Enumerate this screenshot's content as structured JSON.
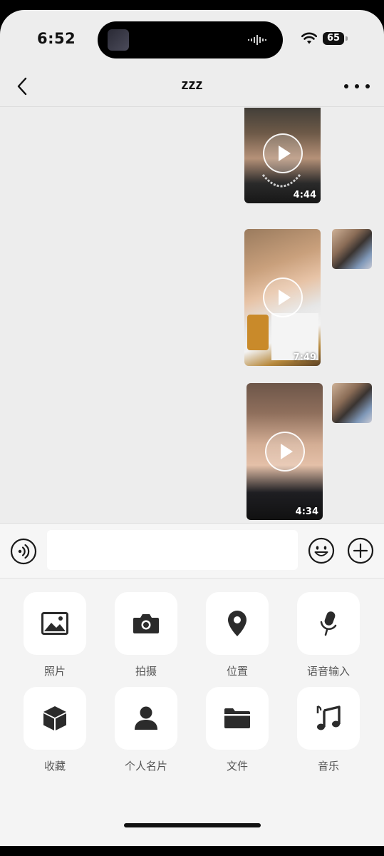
{
  "status_bar": {
    "time": "6:52",
    "battery": "65"
  },
  "header": {
    "title": "zzz"
  },
  "messages": [
    {
      "type": "video",
      "duration": "4:44"
    },
    {
      "type": "video",
      "duration": "7:49"
    },
    {
      "type": "video",
      "duration": "4:34"
    }
  ],
  "input": {
    "value": "",
    "placeholder": ""
  },
  "tools": [
    {
      "label": "照片",
      "icon": "image-icon"
    },
    {
      "label": "拍摄",
      "icon": "camera-icon"
    },
    {
      "label": "位置",
      "icon": "location-pin-icon"
    },
    {
      "label": "语音输入",
      "icon": "microphone-icon"
    },
    {
      "label": "收藏",
      "icon": "cube-icon"
    },
    {
      "label": "个人名片",
      "icon": "person-icon"
    },
    {
      "label": "文件",
      "icon": "folder-icon"
    },
    {
      "label": "音乐",
      "icon": "music-note-icon"
    }
  ],
  "colors": {
    "chat_bg": "#ededed",
    "panel_bg": "#f4f4f4",
    "icon": "#2b2b2b"
  }
}
